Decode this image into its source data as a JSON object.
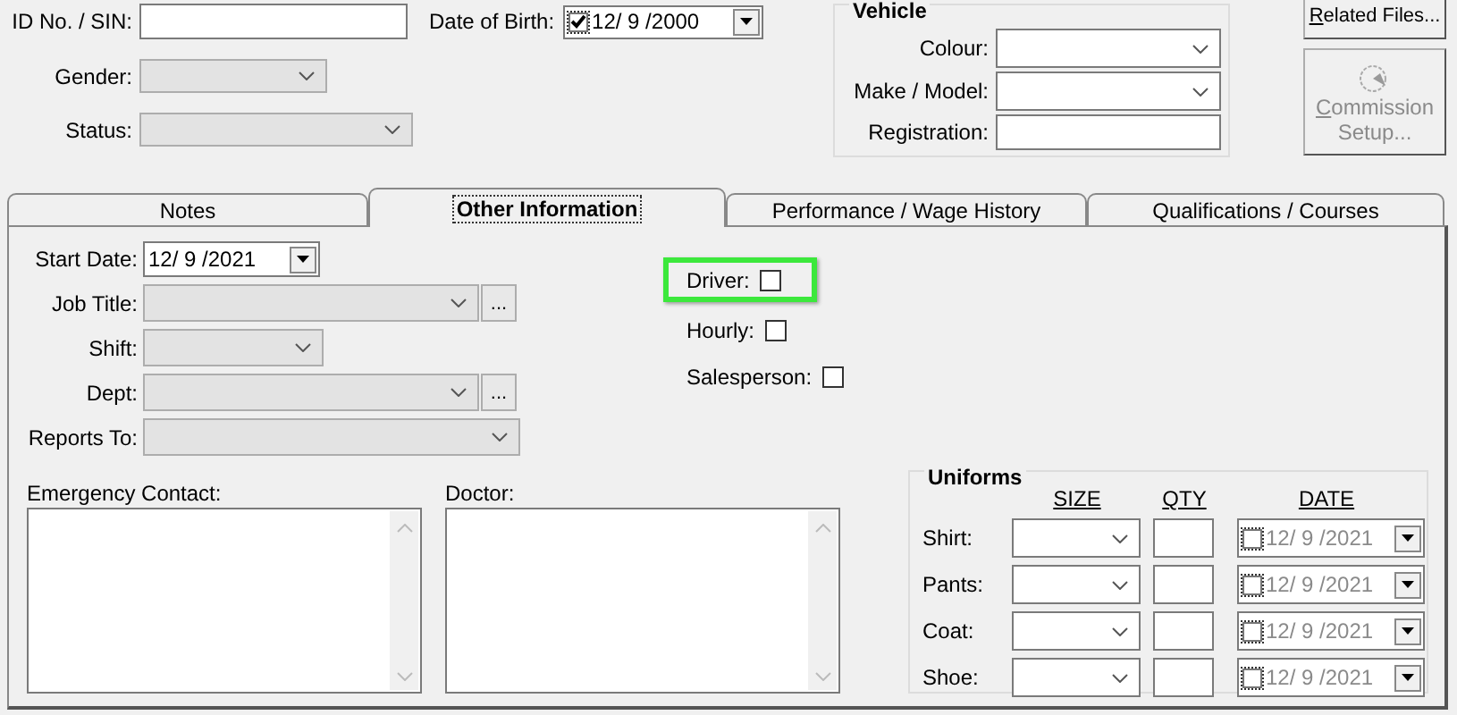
{
  "personal": [
    {
      "label": "ID No. / SIN:",
      "kind": "text",
      "disabled": false
    },
    {
      "label": "Gender:",
      "kind": "combo",
      "disabled": true
    },
    {
      "label": "Status:",
      "kind": "combo",
      "disabled": true
    }
  ],
  "date_of_birth": {
    "label": "Date of Birth:",
    "value": "12/ 9 /2000",
    "checked": true
  },
  "vehicle": {
    "title": "Vehicle",
    "fields": [
      {
        "label": "Colour:",
        "kind": "combo"
      },
      {
        "label": "Make / Model:",
        "kind": "combo"
      },
      {
        "label": "Registration:",
        "kind": "text"
      }
    ]
  },
  "buttons": [
    {
      "label": "Related Files...",
      "disabled": false
    },
    {
      "label": "Commission Setup...",
      "disabled": true
    }
  ],
  "tabs": [
    {
      "label": "Notes",
      "selected": false
    },
    {
      "label": "Other Information",
      "selected": true
    },
    {
      "label": "Performance / Wage History",
      "selected": false
    },
    {
      "label": "Qualifications / Courses",
      "selected": false
    }
  ],
  "start_date": {
    "label": "Start Date:",
    "value": "12/ 9 /2021"
  },
  "job_fields": [
    {
      "label": "Job Title:",
      "disabled": true,
      "browse": "..."
    },
    {
      "label": "Shift:",
      "disabled": true
    },
    {
      "label": "Dept:",
      "disabled": true,
      "browse": "..."
    },
    {
      "label": "Reports To:",
      "disabled": true
    }
  ],
  "flags": [
    {
      "label": "Driver:",
      "checked": false,
      "highlighted": true
    },
    {
      "label": "Hourly:",
      "checked": false,
      "highlighted": false
    },
    {
      "label": "Salesperson:",
      "checked": false,
      "highlighted": false
    }
  ],
  "notes": [
    {
      "label": "Emergency Contact:"
    },
    {
      "label": "Doctor:"
    }
  ],
  "uniforms": {
    "title": "Uniforms",
    "columns": [
      "SIZE",
      "QTY",
      "DATE"
    ],
    "rows": [
      {
        "label": "Shirt:",
        "checked": false,
        "date": "12/ 9 /2021"
      },
      {
        "label": "Pants:",
        "checked": false,
        "date": "12/ 9 /2021"
      },
      {
        "label": "Coat:",
        "checked": false,
        "date": "12/ 9 /2021"
      },
      {
        "label": "Shoe:",
        "checked": false,
        "date": "12/ 9 /2021"
      }
    ]
  }
}
